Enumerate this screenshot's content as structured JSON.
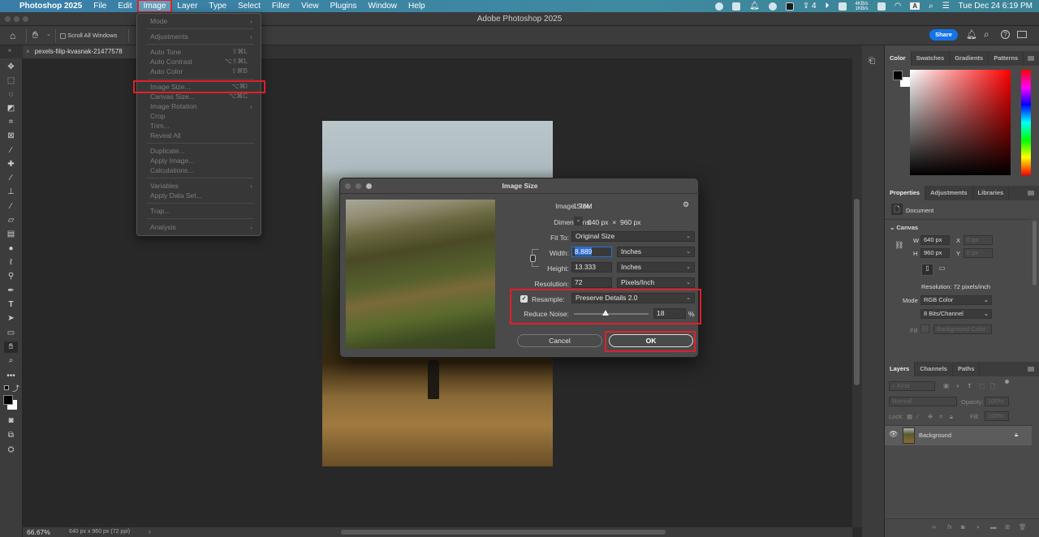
{
  "menubar": {
    "app_name": "Photoshop 2025",
    "items": [
      "File",
      "Edit",
      "Image",
      "Layer",
      "Type",
      "Select",
      "Filter",
      "View",
      "Plugins",
      "Window",
      "Help"
    ],
    "active_item": "Image",
    "status": {
      "badge_count": "4",
      "net_up": "4KB/s",
      "net_down": "1KB/s",
      "input_source": "A",
      "datetime": "Tue Dec 24  6:19 PM"
    }
  },
  "window": {
    "title": "Adobe Photoshop 2025"
  },
  "options_bar": {
    "scroll_all_windows_label": "Scroll All Windows",
    "scroll_all_windows_checked": false,
    "share_label": "Share"
  },
  "document_tab": {
    "name": "pexels-filip-kvasnak-21477578"
  },
  "image_menu": {
    "items": [
      {
        "label": "Mode",
        "submenu": true
      },
      {
        "label": "Adjustments",
        "submenu": true
      },
      {
        "label": "Auto Tone",
        "shortcut": "⇧⌘L"
      },
      {
        "label": "Auto Contrast",
        "shortcut": "⌥⇧⌘L"
      },
      {
        "label": "Auto Color",
        "shortcut": "⇧⌘B"
      },
      {
        "label": "Image Size...",
        "shortcut": "⌥⌘I",
        "highlighted": true
      },
      {
        "label": "Canvas Size...",
        "shortcut": "⌥⌘C"
      },
      {
        "label": "Image Rotation",
        "submenu": true
      },
      {
        "label": "Crop"
      },
      {
        "label": "Trim..."
      },
      {
        "label": "Reveal All"
      },
      {
        "label": "Duplicate..."
      },
      {
        "label": "Apply Image..."
      },
      {
        "label": "Calculations..."
      },
      {
        "label": "Variables",
        "submenu": true
      },
      {
        "label": "Apply Data Set..."
      },
      {
        "label": "Trap..."
      },
      {
        "label": "Analysis",
        "submenu": true
      }
    ],
    "submenu_arrow": "›"
  },
  "dialog": {
    "title": "Image Size",
    "image_size_label": "Image Size:",
    "image_size_value": "1.76M",
    "dimensions_label": "Dimensions:",
    "dimensions_w": "640 px",
    "dimensions_x": "×",
    "dimensions_h": "960 px",
    "fit_to_label": "Fit To:",
    "fit_to_value": "Original Size",
    "width_label": "Width:",
    "width_value": "8.889",
    "width_unit": "Inches",
    "height_label": "Height:",
    "height_value": "13.333",
    "height_unit": "Inches",
    "resolution_label": "Resolution:",
    "resolution_value": "72",
    "resolution_unit": "Pixels/Inch",
    "resample_label": "Resample:",
    "resample_checked": true,
    "resample_value": "Preserve Details 2.0",
    "reduce_noise_label": "Reduce Noise:",
    "reduce_noise_value": "18",
    "reduce_noise_percent": 18,
    "percent_sign": "%",
    "cancel_label": "Cancel",
    "ok_label": "OK"
  },
  "status_bar": {
    "zoom": "66.67%",
    "doc_info": "640 px x 960 px (72 ppi)"
  },
  "color_panel": {
    "tabs": [
      "Color",
      "Swatches",
      "Gradients",
      "Patterns"
    ],
    "active_tab": "Color",
    "hue": "#ff0000",
    "foreground": "#000000",
    "background": "#ffffff"
  },
  "properties_panel": {
    "tabs": [
      "Properties",
      "Adjustments",
      "Libraries"
    ],
    "active_tab": "Properties",
    "doc_label": "Document",
    "section": "Canvas",
    "w_label": "W",
    "w_value": "640 px",
    "h_label": "H",
    "h_value": "960 px",
    "x_label": "X",
    "x_placeholder": "0 px",
    "y_label": "Y",
    "y_placeholder": "0 px",
    "resolution_text": "Resolution: 72 pixels/inch",
    "mode_label": "Mode",
    "mode_value": "RGB Color",
    "depth_value": "8 Bits/Channel",
    "fill_label": "Fill",
    "fill_value": "Background Color"
  },
  "layers_panel": {
    "tabs": [
      "Layers",
      "Channels",
      "Paths"
    ],
    "active_tab": "Layers",
    "kind_placeholder": "Kind",
    "blend_mode": "Normal",
    "opacity_label": "Opacity:",
    "opacity_value": "100%",
    "lock_label": "Lock:",
    "fill_label": "Fill:",
    "fill_value": "100%",
    "layers": [
      {
        "name": "Background",
        "visible": true,
        "locked": true
      }
    ]
  },
  "colors": {
    "accent_blue": "#1473e6",
    "highlight_red": "#e0202a"
  }
}
